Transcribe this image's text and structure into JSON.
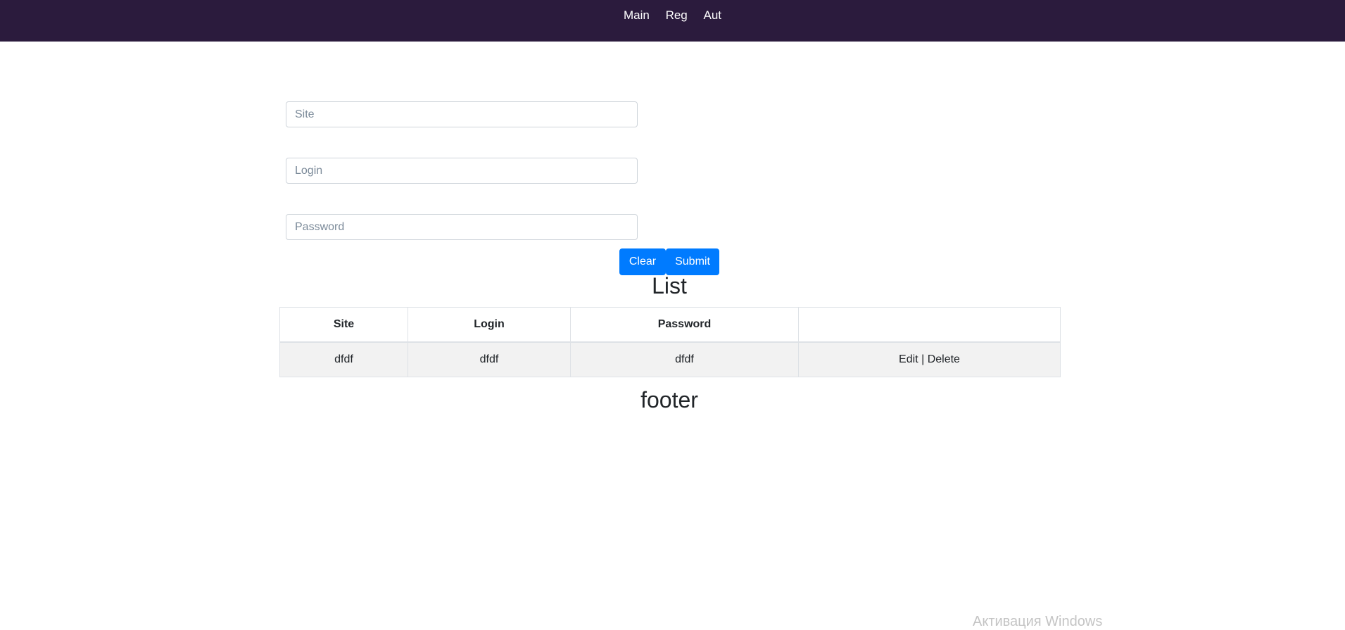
{
  "nav": {
    "items": [
      "Main",
      "Reg",
      "Aut"
    ]
  },
  "form": {
    "site_placeholder": "Site",
    "login_placeholder": "Login",
    "password_placeholder": "Password",
    "clear_label": "Clear",
    "submit_label": "Submit"
  },
  "list": {
    "title": "List",
    "columns": [
      "Site",
      "Login",
      "Password",
      ""
    ],
    "rows": [
      {
        "site": "dfdf",
        "login": "dfdf",
        "password": "dfdf",
        "edit": "Edit",
        "separator": "|",
        "delete": "Delete"
      }
    ]
  },
  "footer": {
    "title": "footer"
  },
  "watermark": {
    "text": "Активация Windows"
  },
  "colors": {
    "navbar": "#2b1b3d",
    "primary": "#007bff",
    "row_stripe": "#f2f2f2"
  }
}
